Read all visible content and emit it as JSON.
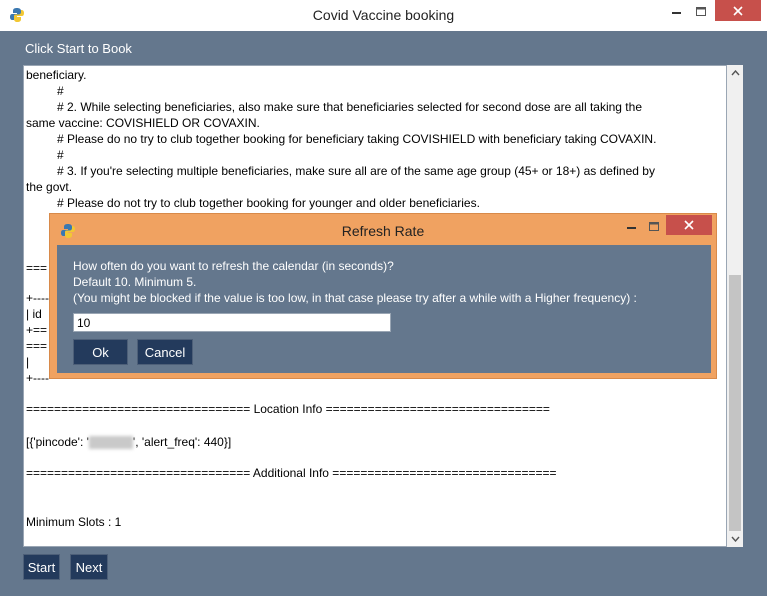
{
  "window": {
    "title": "Covid Vaccine booking"
  },
  "header": {
    "label": "Click Start to Book"
  },
  "textarea": {
    "lines": [
      "beneficiary.",
      "#",
      "# 2. While selecting beneficiaries, also make sure that beneficiaries selected for second dose are all taking the",
      "same vaccine: COVISHIELD OR COVAXIN.",
      "#     Please do no try to club together booking for beneficiary taking COVISHIELD with beneficiary taking COVAXIN.",
      "#",
      "# 3. If you're selecting multiple beneficiaries, make sure all are of the same age group (45+ or 18+) as defined by",
      "the govt.",
      "#     Please do not try to club together booking for younger and older beneficiaries.",
      "===",
      "+----",
      "|   id",
      "+==",
      "===",
      "|",
      "+----",
      "================================ Location Info ================================",
      "[{'pincode': '",
      "', 'alert_freq': 440}]",
      "================================ Additional Info ================================",
      "Minimum Slots : 1"
    ]
  },
  "buttons": {
    "start": "Start",
    "next": "Next"
  },
  "dialog": {
    "title": "Refresh Rate",
    "prompt_line1": "How often do you want to refresh the calendar (in seconds)?",
    "prompt_line2": " Default 10. Minimum 5.",
    "prompt_line3": "(You might be blocked if the value is too low, in that case please try after a while with a Higher frequency) :",
    "input_value": "10",
    "ok": "Ok",
    "cancel": "Cancel"
  },
  "colors": {
    "frame_bg": "#64778d",
    "button_bg": "#233a5c",
    "dialog_border": "#f0a261",
    "close_red": "#c7504b"
  }
}
